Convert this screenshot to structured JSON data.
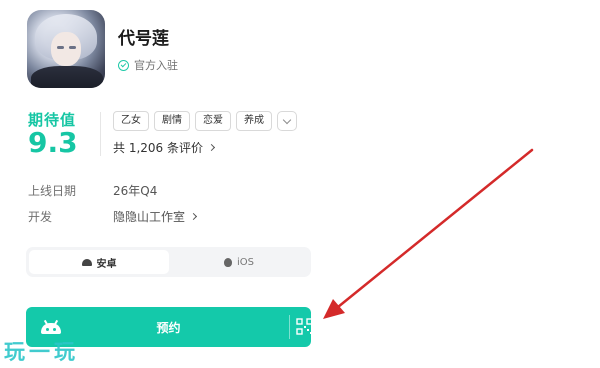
{
  "header": {
    "game_name": "代号莲",
    "official_label": "官方入驻"
  },
  "rating": {
    "label": "期待值",
    "score": "9.3",
    "tags": [
      "乙女",
      "剧情",
      "恋爱",
      "养成"
    ],
    "reviews_text": "共 1,206 条评价"
  },
  "info": {
    "release_label": "上线日期",
    "release_value": "26年Q4",
    "developer_label": "开发",
    "developer_value": "隐隐山工作室"
  },
  "platforms": {
    "android": "安卓",
    "ios": "iOS",
    "selected": "安卓"
  },
  "action": {
    "reserve_label": "预约"
  },
  "watermark": "玩一玩",
  "colors": {
    "accent": "#14c9aa",
    "arrow": "#d42a2a"
  }
}
